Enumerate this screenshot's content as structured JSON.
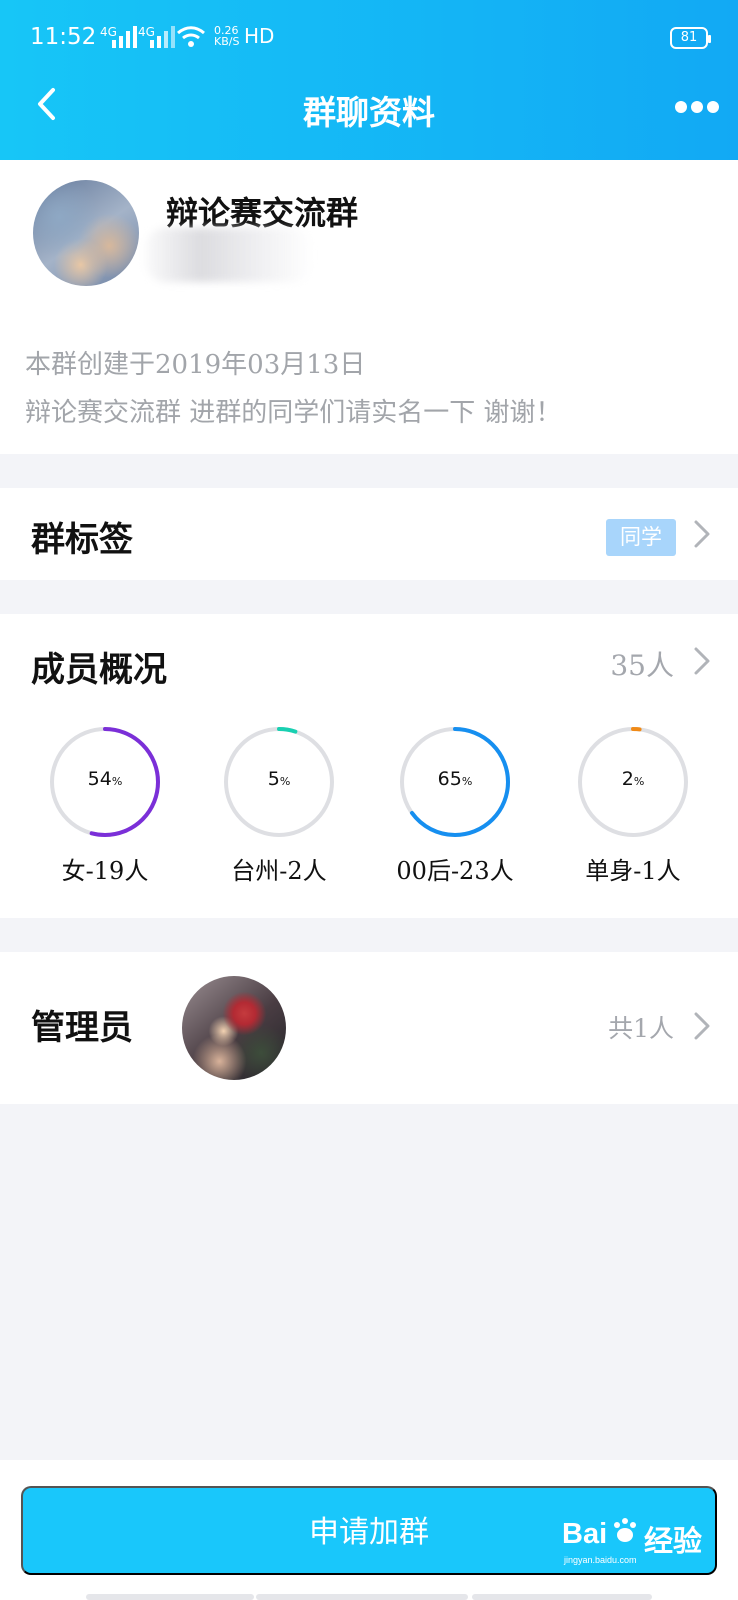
{
  "status_bar": {
    "time": "11:52",
    "network_1": "4G",
    "network_2": "4G",
    "speed": "0.26\nKB/S",
    "hd": "HD",
    "battery": "81"
  },
  "navigation": {
    "title": "群聊资料",
    "back_icon": "chevron-left-icon",
    "more_icon": "more-horizontal-icon"
  },
  "group": {
    "name": "辩论赛交流群",
    "created": "本群创建于2019年03月13日",
    "description": "辩论赛交流群 进群的同学们请实名一下 谢谢！"
  },
  "tags": {
    "label": "群标签",
    "value": "同学"
  },
  "members": {
    "label": "成员概况",
    "count": "35人",
    "stats": [
      {
        "value": "54",
        "unit": "%",
        "label": "女-19人",
        "fraction": 0.54,
        "color": "#7b2fd8"
      },
      {
        "value": "5",
        "unit": "%",
        "label": "台州-2人",
        "fraction": 0.05,
        "color": "#18d0b1"
      },
      {
        "value": "65",
        "unit": "%",
        "label": "00后-23人",
        "fraction": 0.65,
        "color": "#168ff0"
      },
      {
        "value": "2",
        "unit": "%",
        "label": "单身-1人",
        "fraction": 0.02,
        "color": "#f08a17"
      }
    ]
  },
  "admins": {
    "label": "管理员",
    "count": "共1人"
  },
  "actions": {
    "join": "申请加群"
  },
  "watermark": {
    "brand": "Bai",
    "brand_suffix": "经验",
    "site": "jingyan.baidu.com"
  },
  "colors": {
    "header_start": "#17c6f7",
    "header_end": "#12a9f4",
    "tag": "#a8d5fb",
    "button": "#19c7fb",
    "muted_text": "#a4a7ad"
  }
}
